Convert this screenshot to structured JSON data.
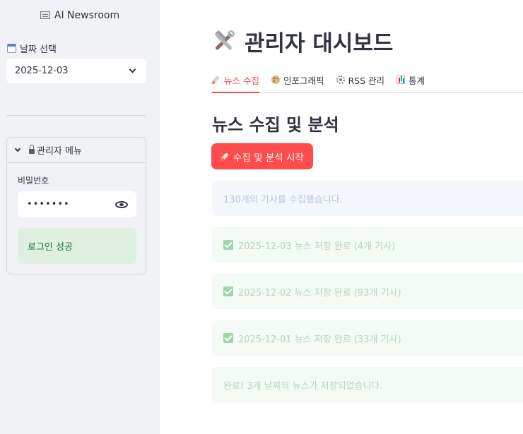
{
  "sidebar": {
    "app_title": "AI Newsroom",
    "app_icon": "newspaper-icon",
    "date_label": "날짜 선택",
    "date_value": "2025-12-03",
    "admin_menu_label": "관리자 메뉴",
    "password_label": "비밀번호",
    "password_mask": "•••••••",
    "login_status": "로그인 성공"
  },
  "main": {
    "title": "관리자 대시보드",
    "title_icon": "tools-icon",
    "tabs": [
      {
        "label": "뉴스 수집",
        "icon": "rocket-icon",
        "active": true
      },
      {
        "label": "인포그래픽",
        "icon": "palette-icon",
        "active": false
      },
      {
        "label": "RSS 관리",
        "icon": "gear-icon",
        "active": false
      },
      {
        "label": "통계",
        "icon": "bar-chart-icon",
        "active": false
      }
    ],
    "section_title": "뉴스 수집 및 분석",
    "start_button": "수집 및 분석 시작",
    "messages": {
      "collected": "130개의 기사를 수집했습니다.",
      "saved": [
        "2025-12-03 뉴스 저장 완료 (4개 기사)",
        "2025-12-02 뉴스 저장 완료 (93개 기사)",
        "2025-12-01 뉴스 저장 완료 (33개 기사)"
      ],
      "done": "완료! 3개 날짜의 뉴스가 저장되었습니다."
    }
  },
  "colors": {
    "accent": "#ff4b4b",
    "sidebar_bg": "#f0f2f6",
    "success_bg": "#dff0e3",
    "success_text": "#177233"
  }
}
